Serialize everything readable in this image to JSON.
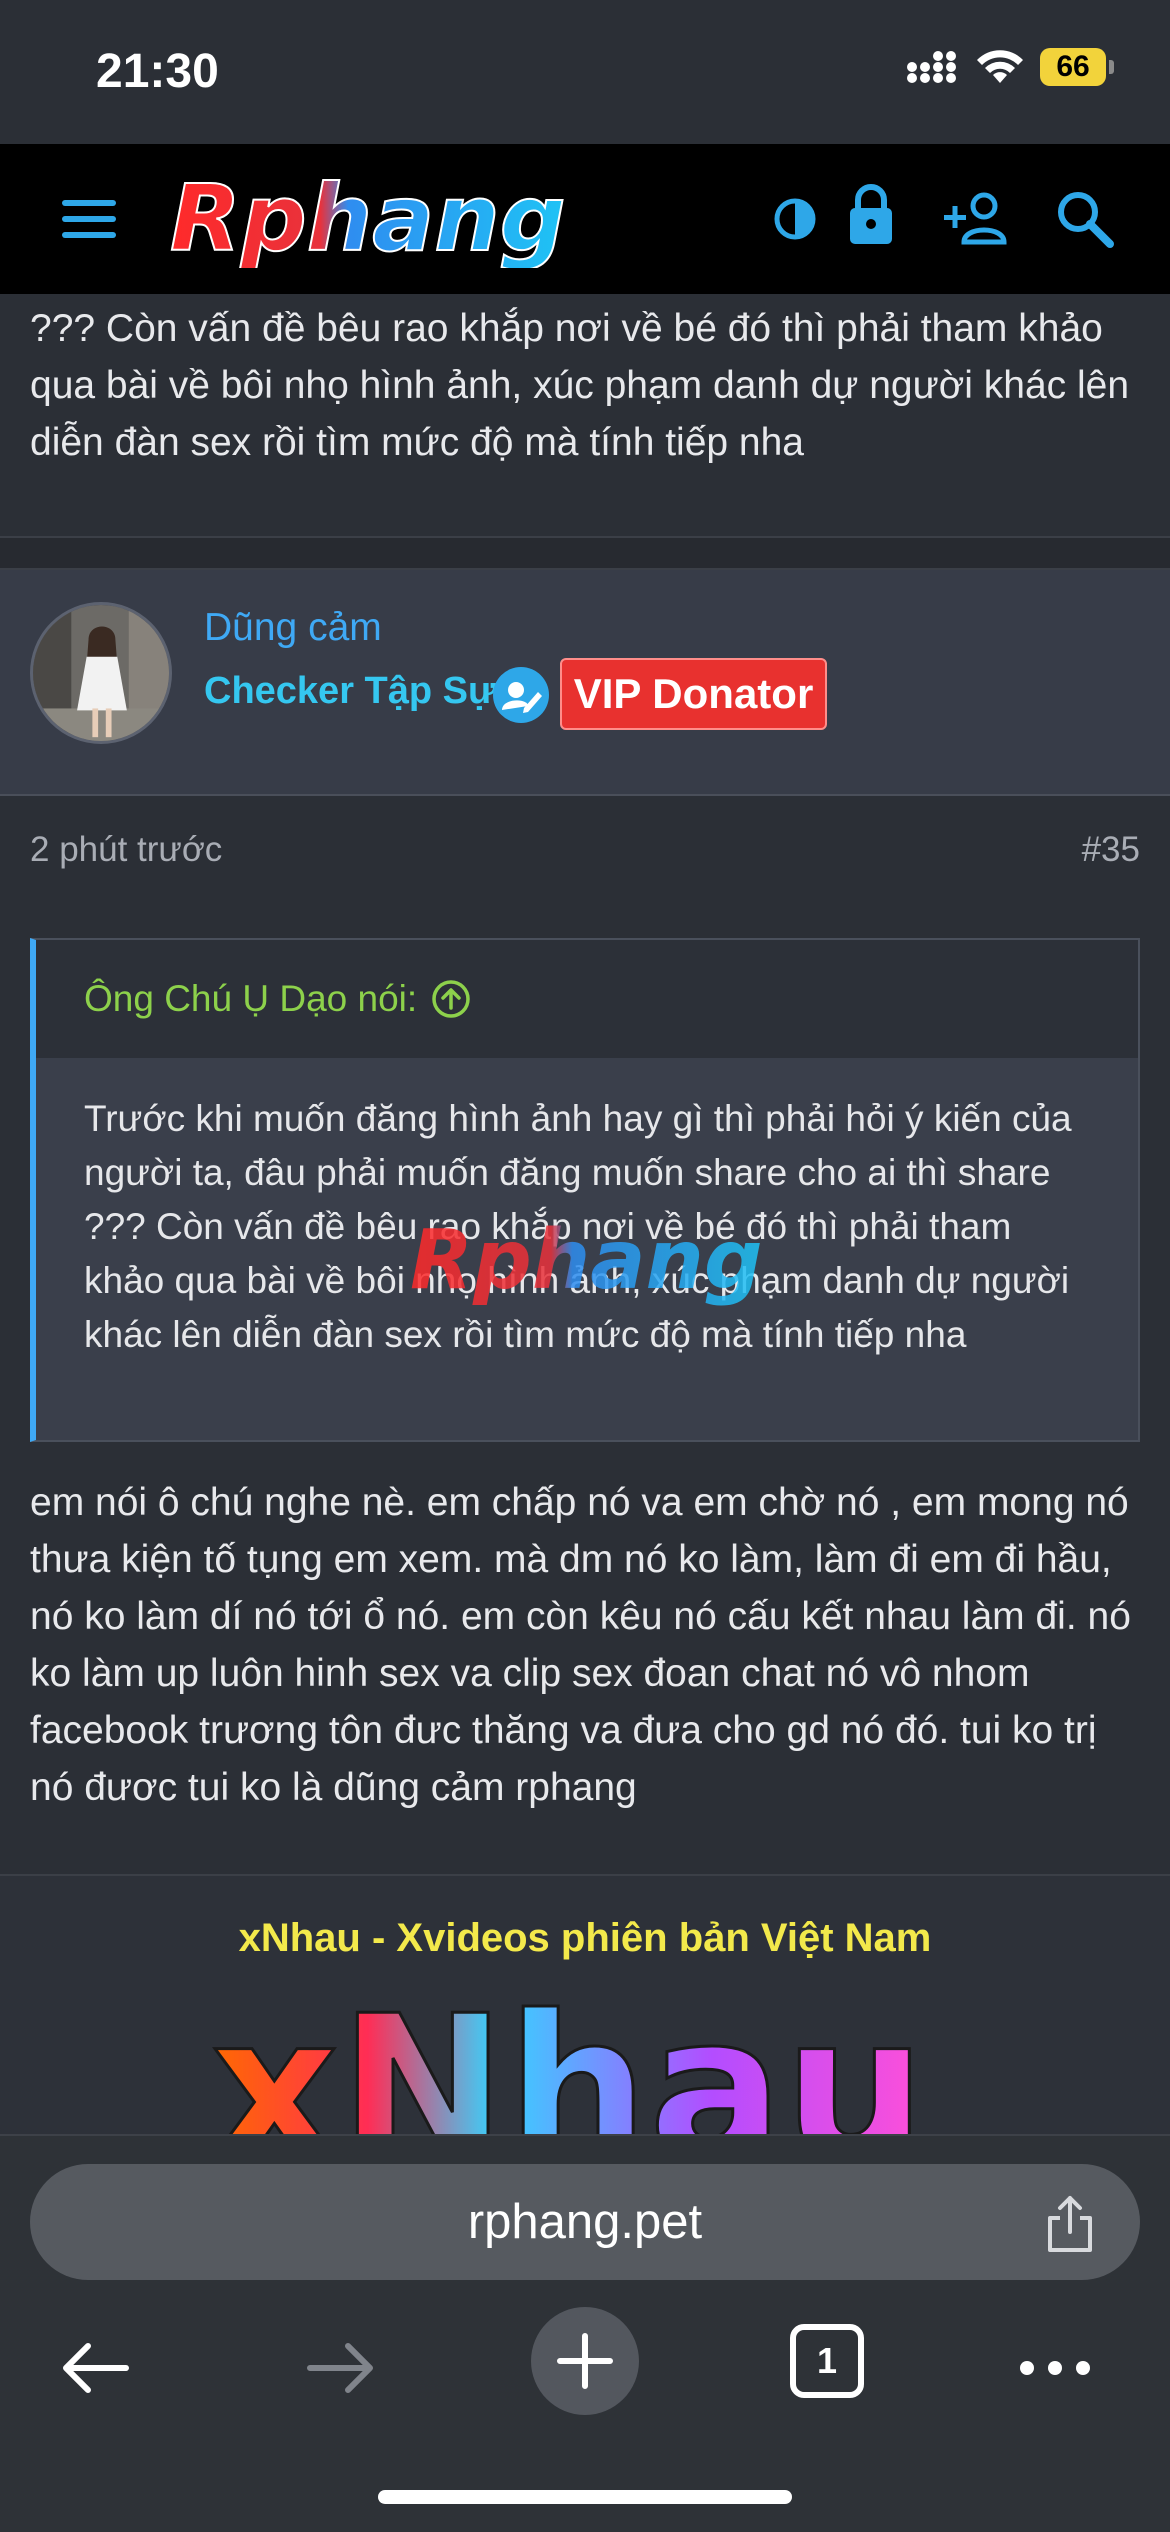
{
  "status_bar": {
    "time": "21:30",
    "battery": "66"
  },
  "header": {
    "logo_text": "Rphang",
    "icons": [
      "menu-icon",
      "theme-toggle-icon",
      "lock-icon",
      "add-user-icon",
      "search-icon"
    ]
  },
  "previous_post": {
    "text": "??? Còn vấn đề bêu rao khắp nơi về bé đó thì phải tham khảo qua bài về bôi nhọ hình ảnh, xúc phạm danh dự người khác lên diễn đàn sex rồi tìm mức độ mà tính tiếp nha"
  },
  "author": {
    "name": "Dũng cảm",
    "title": "Checker Tập Sự",
    "badge": "VIP Donator"
  },
  "post": {
    "time": "2 phút trước",
    "number": "#35",
    "quote_author": "Ông Chú Ụ Dạo nói:",
    "quote_text": "Trước khi muốn đăng hình ảnh hay gì thì phải hỏi ý kiến của người ta, đâu phải muốn đăng muốn share cho ai thì share ??? Còn vấn đề bêu rao khắp nơi về bé đó thì phải tham khảo qua bài về bôi nhọ hình ảnh, xúc phạm danh dự người khác lên diễn đàn sex rồi tìm mức độ mà tính tiếp nha",
    "reply_text": "em nói ô chú nghe nè. em chấp nó va em chờ nó , em mong nó thưa kiện tố tụng em xem. mà dm nó ko làm, làm đi em đi hầu, nó ko làm dí nó tới ổ nó. em còn kêu nó cấu kết nhau làm đi. nó ko làm up luôn hinh sex va clip sex đoan chat nó vô nhom facebook trương tôn đưc thăng va đưa cho gd nó đó. tui ko trị nó đươc tui ko là dũng cảm rphang"
  },
  "ad": {
    "title": "xNhau - Xvideos phiên bản Việt Nam",
    "logo_text": "xNhau"
  },
  "browser": {
    "url": "rphang.pet",
    "tab_count": "1"
  },
  "colors": {
    "background": "#2b2f36",
    "link_blue": "#3fa9f5",
    "vip_red": "#e8312f",
    "quote_green": "#8dd14b",
    "ad_yellow": "#f3e94b"
  }
}
